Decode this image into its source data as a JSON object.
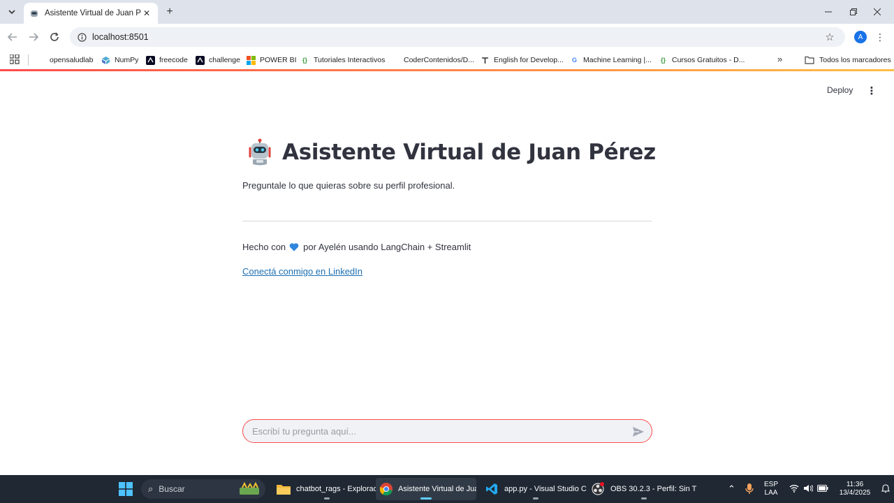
{
  "browser": {
    "tab_title": "Asistente Virtual de Juan Pérez",
    "url": "localhost:8501",
    "profile_initial": "A",
    "bookmarks": [
      {
        "label": "opensaludlab",
        "icon": "blank-icon"
      },
      {
        "label": "NumPy",
        "icon": "numpy-icon"
      },
      {
        "label": "freecode",
        "icon": "freecodecamp-icon"
      },
      {
        "label": "challenge",
        "icon": "challenge-icon"
      },
      {
        "label": "POWER BI",
        "icon": "microsoft-icon"
      },
      {
        "label": "Tutoriales Interactivos",
        "icon": "braces-icon"
      },
      {
        "label": "CoderContenidos/D...",
        "icon": "blank-icon"
      },
      {
        "label": "English for Develop...",
        "icon": "flag-icon"
      },
      {
        "label": "Machine Learning  |...",
        "icon": "google-icon"
      },
      {
        "label": "Cursos Gratuitos - D...",
        "icon": "braces-icon"
      }
    ],
    "all_bookmarks": "Todos los marcadores"
  },
  "app": {
    "deploy_label": "Deploy",
    "title": "Asistente Virtual de Juan Pérez",
    "subtitle": "Preguntale lo que quieras sobre su perfil profesional.",
    "credits_before": "Hecho con",
    "credits_after": "por Ayelén usando LangChain + Streamlit",
    "linkedin_link": "Conectá conmigo en LinkedIn",
    "chat_placeholder": "Escribí tu pregunta aquí...",
    "colors": {
      "accent": "#ff4b4b",
      "text": "#31333f",
      "link": "#1c6fb2"
    }
  },
  "taskbar": {
    "search_label": "Buscar",
    "apps": [
      {
        "label": "chatbot_rags - Explorad",
        "icon": "folder-icon"
      },
      {
        "label": "Asistente Virtual de Juan",
        "icon": "chrome-icon"
      },
      {
        "label": "app.py - Visual Studio C",
        "icon": "vscode-icon"
      },
      {
        "label": "OBS 30.2.3 - Perfil: Sin T",
        "icon": "obs-icon"
      }
    ],
    "language": "ESP",
    "layout": "LAA",
    "time": "11:36",
    "date": "13/4/2025"
  }
}
